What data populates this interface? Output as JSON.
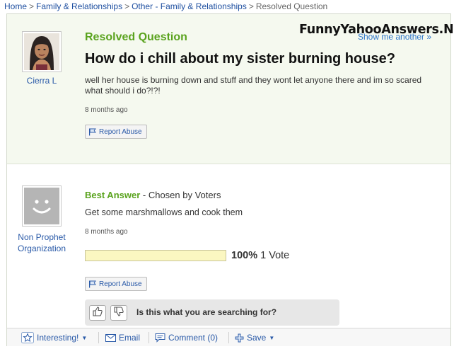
{
  "breadcrumb": {
    "items": [
      "Home",
      "Family & Relationships",
      "Other - Family & Relationships"
    ],
    "current": "Resolved Question",
    "separator": ">"
  },
  "watermark": "FunnyYahooAnswers.Net",
  "show_me_another": "Show me another »",
  "question": {
    "status": "Resolved Question",
    "asker": "Cierra L",
    "title": "How do i chill about my sister burning house?",
    "body": "well her house is burning down and stuff and they wont let anyone there and im so scared what should i do?!?!",
    "time": "8 months ago",
    "report_label": "Report Abuse"
  },
  "answer": {
    "label": "Best Answer",
    "chosen_by": " - Chosen by Voters",
    "answerer": "Non Prophet Organization",
    "body": "Get some marshmallows and cook them",
    "time": "8 months ago",
    "vote_percent": "100%",
    "vote_fraction": 1.0,
    "vote_count": "1 Vote",
    "report_label": "Report Abuse",
    "search_prompt": "Is this what you are searching for?"
  },
  "toolbar": {
    "interesting": "Interesting!",
    "email": "Email",
    "comment": "Comment (0)",
    "save": "Save"
  },
  "colors": {
    "accent_green": "#5aa31e",
    "link_blue": "#2a5aa8",
    "question_bg": "#f5f9ef",
    "vote_bar": "#fbf7c1"
  },
  "icons": [
    "flag-icon",
    "star-icon",
    "mail-icon",
    "comment-icon",
    "plus-icon",
    "thumbs-up-icon",
    "thumbs-down-icon",
    "caret-down-icon"
  ]
}
